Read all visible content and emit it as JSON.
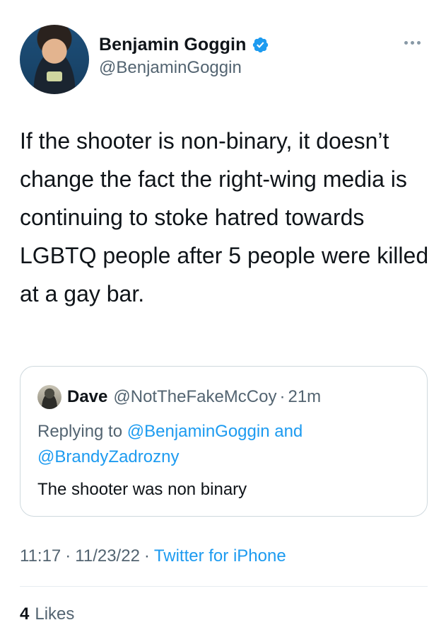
{
  "author": {
    "display_name": "Benjamin Goggin",
    "handle": "@BenjaminGoggin",
    "verified_icon": "verified-badge-icon",
    "verified_color": "#1d9bf0"
  },
  "tweet": {
    "text": "If the shooter is non-binary, it doesn’t change the fact the right-wing media is continuing to stoke hatred towards LGBTQ people after 5 people were killed at a gay bar."
  },
  "quoted_tweet": {
    "name": "Dave",
    "handle": "@NotTheFakeMcCoy",
    "sep": "·",
    "time": "21m",
    "replying_prefix": "Replying to",
    "mention_1": "@BenjaminGoggin",
    "and": "and",
    "mention_2": "@BrandyZadrozny",
    "text": "The shooter was non binary"
  },
  "meta": {
    "time": "11:17",
    "sep1": "·",
    "date": "11/23/22",
    "sep2": "·",
    "source": "Twitter for iPhone"
  },
  "stats": {
    "likes_count": "4",
    "likes_label": "Likes"
  },
  "colors": {
    "accent": "#1d9bf0",
    "secondary_text": "#536471",
    "primary_text": "#0f1419"
  }
}
